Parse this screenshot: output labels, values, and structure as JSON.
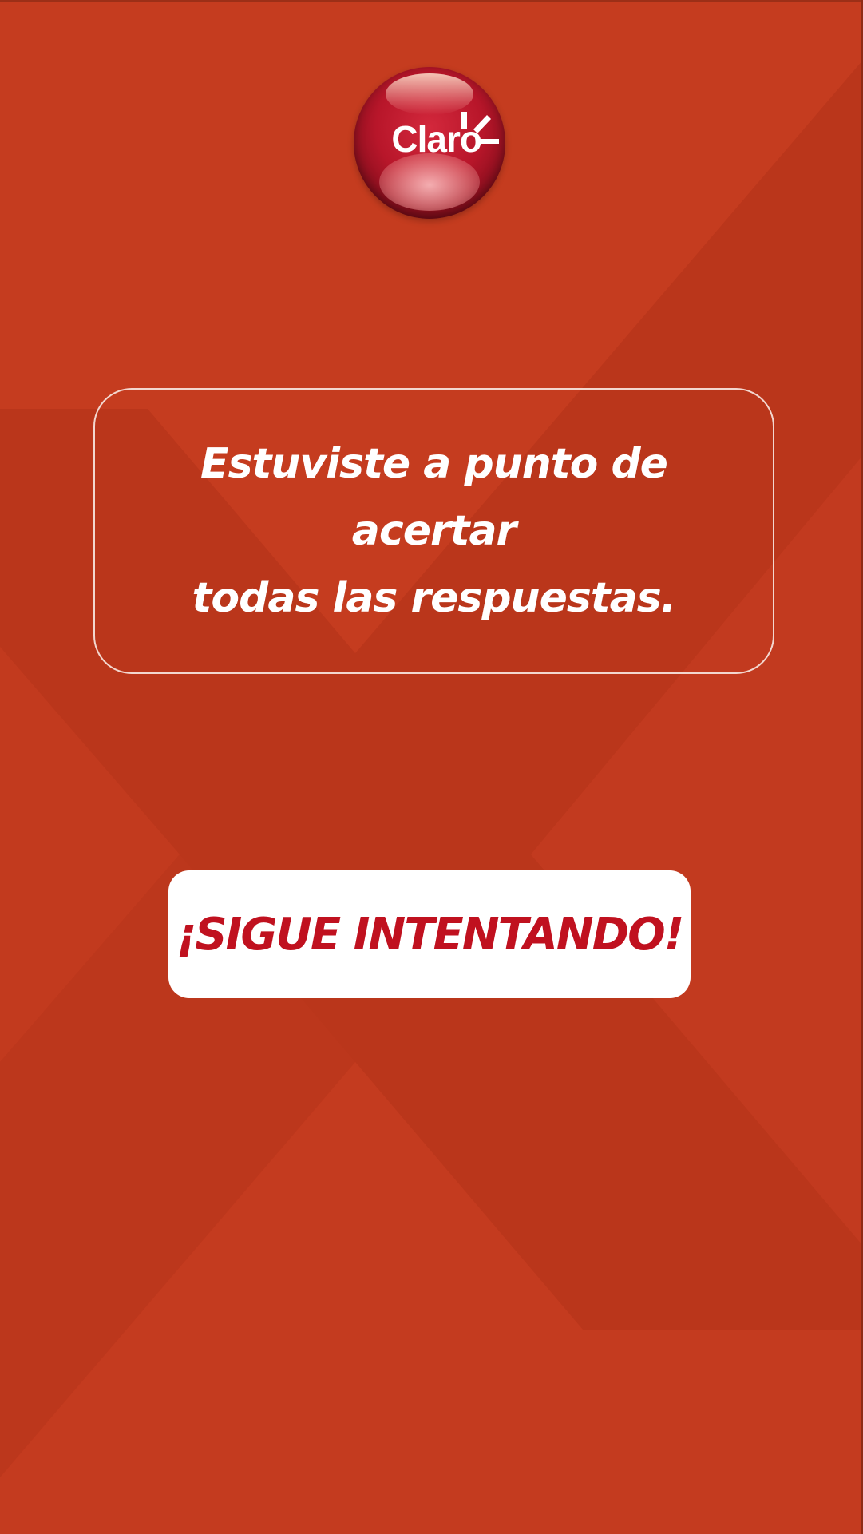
{
  "logo": {
    "text": "Claro",
    "brand_color": "#c0111f"
  },
  "message": {
    "line1": "Estuviste a punto de acertar",
    "line2": "todas las respuestas."
  },
  "action": {
    "retry_label": "¡SIGUE INTENTANDO!"
  },
  "colors": {
    "background": "#c33b1f",
    "background_dark": "#b8361c",
    "button_bg": "#ffffff",
    "button_text": "#c0111f"
  }
}
